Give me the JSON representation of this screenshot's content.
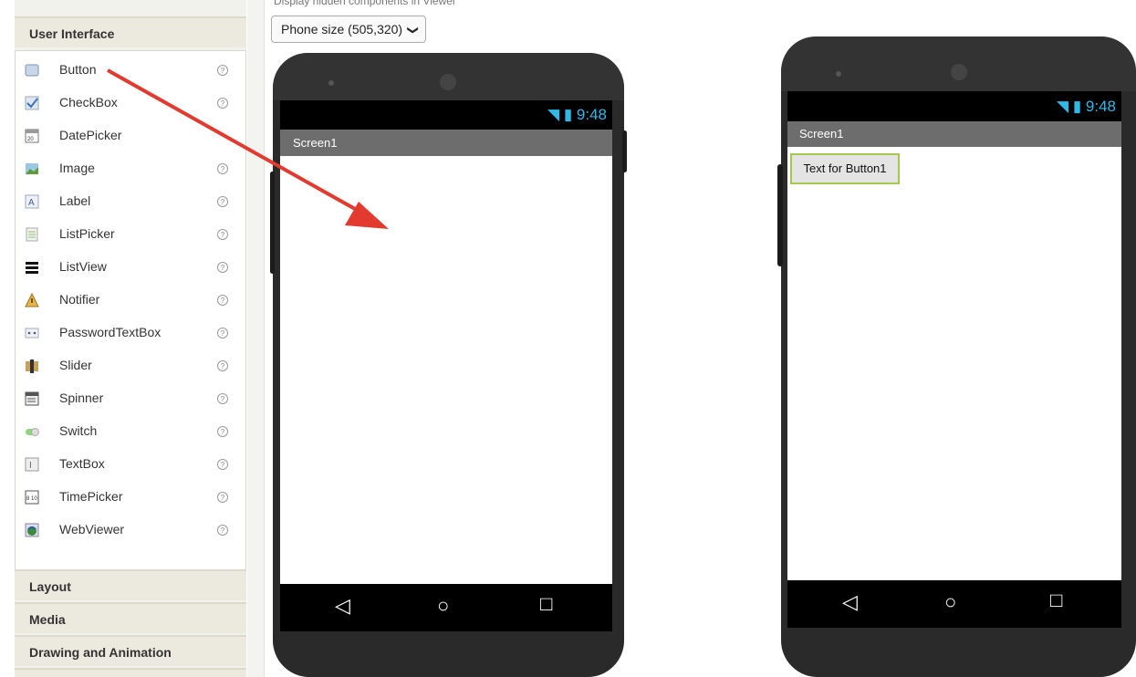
{
  "palette": {
    "categories": {
      "ui": "User Interface",
      "layout": "Layout",
      "media": "Media",
      "drawing": "Drawing and Animation"
    },
    "help_glyph": "?",
    "items": [
      {
        "label": "Button",
        "icon": "button-icon"
      },
      {
        "label": "CheckBox",
        "icon": "checkbox-icon"
      },
      {
        "label": "DatePicker",
        "icon": "datepicker-icon"
      },
      {
        "label": "Image",
        "icon": "image-icon"
      },
      {
        "label": "Label",
        "icon": "label-icon"
      },
      {
        "label": "ListPicker",
        "icon": "listpicker-icon"
      },
      {
        "label": "ListView",
        "icon": "listview-icon"
      },
      {
        "label": "Notifier",
        "icon": "notifier-icon"
      },
      {
        "label": "PasswordTextBox",
        "icon": "passwordtextbox-icon"
      },
      {
        "label": "Slider",
        "icon": "slider-icon"
      },
      {
        "label": "Spinner",
        "icon": "spinner-icon"
      },
      {
        "label": "Switch",
        "icon": "switch-icon"
      },
      {
        "label": "TextBox",
        "icon": "textbox-icon"
      },
      {
        "label": "TimePicker",
        "icon": "timepicker-icon"
      },
      {
        "label": "WebViewer",
        "icon": "webviewer-icon"
      }
    ]
  },
  "viewer": {
    "hidden_note": "Display hidden components in Viewer",
    "size_select": "Phone size (505,320)",
    "chevron": "❯"
  },
  "phone_left": {
    "time": "9:48",
    "screen_title": "Screen1",
    "nav": {
      "back": "◁",
      "home": "○",
      "recent": "□"
    }
  },
  "phone_right": {
    "time": "9:48",
    "screen_title": "Screen1",
    "button_text": "Text for Button1",
    "nav": {
      "back": "◁",
      "home": "○",
      "recent": "□"
    }
  },
  "colors": {
    "arrow": "#e23a2e",
    "status_accent": "#2fb9e8",
    "button_border": "#a5c94e"
  }
}
